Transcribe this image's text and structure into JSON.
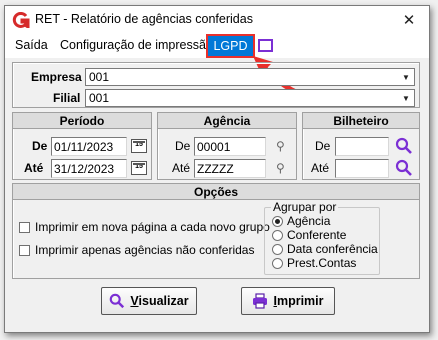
{
  "window": {
    "title": "RET - Relatório de agências conferidas",
    "close_glyph": "✕"
  },
  "menu": {
    "items": [
      "Saída",
      "Configuração de impressão"
    ],
    "highlighted": "LGPD"
  },
  "filters": {
    "empresa_label": "Empresa",
    "empresa_value": "001",
    "filial_label": "Filial",
    "filial_value": "001"
  },
  "periodo": {
    "title": "Período",
    "de_label": "De",
    "de_value": "01/11/2023",
    "ate_label": "Até",
    "ate_value": "31/12/2023",
    "cal_glyph": "15"
  },
  "agencia": {
    "title": "Agência",
    "de_label": "De",
    "de_value": "00001",
    "ate_label": "Até",
    "ate_value": "ZZZZZ"
  },
  "bilheteiro": {
    "title": "Bilheteiro",
    "de_label": "De",
    "de_value": "",
    "ate_label": "Até",
    "ate_value": ""
  },
  "opcoes": {
    "title": "Opções",
    "checkbox_1": "Imprimir em nova página a cada novo grupo",
    "checkbox_2": "Imprimir apenas agências não conferidas",
    "agrupar_title": "Agrupar por",
    "radios": [
      "Agência",
      "Conferente",
      "Data conferência",
      "Prest.Contas"
    ],
    "selected": "Agência"
  },
  "buttons": {
    "visualizar_first": "V",
    "visualizar_rest": "isualizar",
    "imprimir_first": "I",
    "imprimir_rest": "mprimir"
  },
  "colors": {
    "accent": "#0078d7",
    "highlight_border": "#e8302c",
    "search_icon": "#7b2fd4",
    "logo": "#d62b2b"
  }
}
